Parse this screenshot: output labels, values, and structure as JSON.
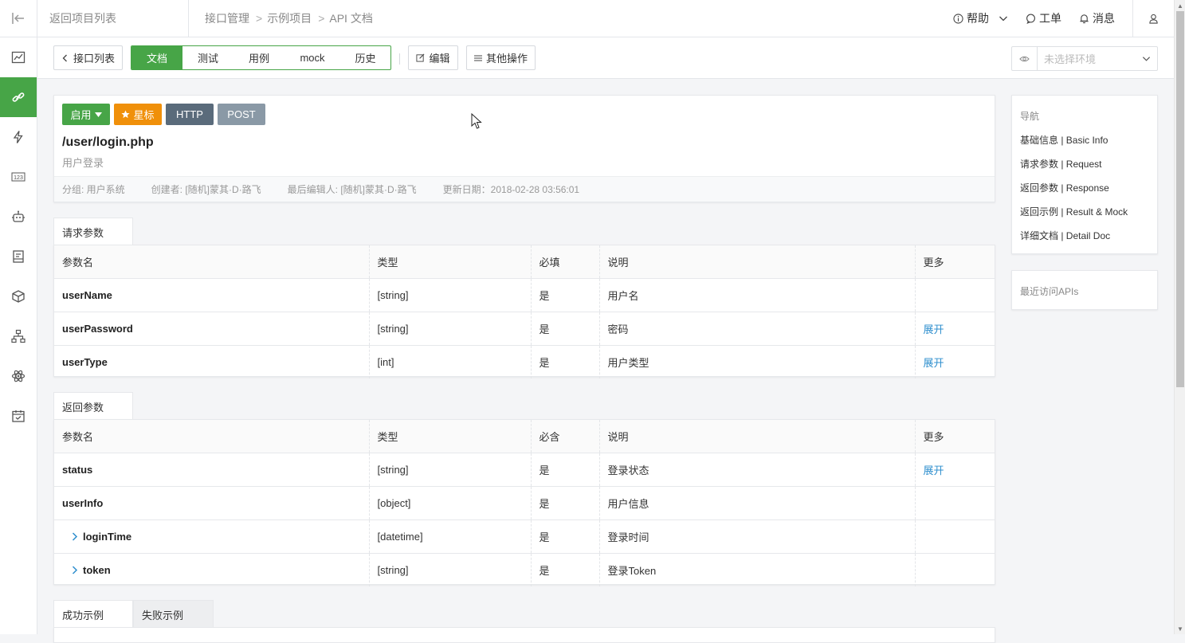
{
  "topbar": {
    "back_label": "返回项目列表",
    "breadcrumbs": [
      "接口管理",
      "示例项目",
      "API 文档"
    ],
    "help_label": "帮助",
    "ticket_label": "工单",
    "message_label": "消息"
  },
  "toolbar": {
    "api_list_label": "接口列表",
    "tabs": [
      "文档",
      "测试",
      "用例",
      "mock",
      "历史"
    ],
    "active_tab": "文档",
    "edit_label": "编辑",
    "more_label": "其他操作",
    "env_placeholder": "未选择环境"
  },
  "api": {
    "status_label": "启用",
    "star_label": "星标",
    "protocol": "HTTP",
    "method": "POST",
    "path": "/user/login.php",
    "name": "用户登录",
    "meta": {
      "group": "分组: 用户系统",
      "creator": "创建者: [随机]蒙其·D·路飞",
      "last_editor": "最后编辑人: [随机]蒙其·D·路飞",
      "updated": "更新日期：2018-02-28 03:56:01"
    }
  },
  "request_params": {
    "tab_label": "请求参数",
    "headers": [
      "参数名",
      "类型",
      "必填",
      "说明",
      "更多"
    ],
    "rows": [
      {
        "name": "userName",
        "type": "[string]",
        "required": "是",
        "desc": "用户名",
        "more": ""
      },
      {
        "name": "userPassword",
        "type": "[string]",
        "required": "是",
        "desc": "密码",
        "more": "展开"
      },
      {
        "name": "userType",
        "type": "[int]",
        "required": "是",
        "desc": "用户类型",
        "more": "展开"
      }
    ]
  },
  "response_params": {
    "tab_label": "返回参数",
    "headers": [
      "参数名",
      "类型",
      "必含",
      "说明",
      "更多"
    ],
    "rows": [
      {
        "name": "status",
        "type": "[string]",
        "required": "是",
        "desc": "登录状态",
        "more": "展开"
      },
      {
        "name": "userInfo",
        "type": "[object]",
        "required": "是",
        "desc": "用户信息",
        "more": ""
      },
      {
        "name": "loginTime",
        "type": "[datetime]",
        "required": "是",
        "desc": "登录时间",
        "more": ""
      },
      {
        "name": "token",
        "type": "[string]",
        "required": "是",
        "desc": "登录Token",
        "more": ""
      }
    ]
  },
  "examples": {
    "success_tab": "成功示例",
    "failure_tab": "失败示例"
  },
  "side_nav": {
    "title": "导航",
    "items": [
      "基础信息 | Basic Info",
      "请求参数 | Request",
      "返回参数 | Response",
      "返回示例 | Result & Mock",
      "详细文档 | Detail Doc"
    ],
    "recent_title": "最近访问APIs"
  },
  "colors": {
    "accent_green": "#47a547",
    "star_orange": "#f0900a",
    "protocol_badge": "#5a6b7b",
    "method_badge": "#8a99a6",
    "link_blue": "#2f8fce"
  }
}
